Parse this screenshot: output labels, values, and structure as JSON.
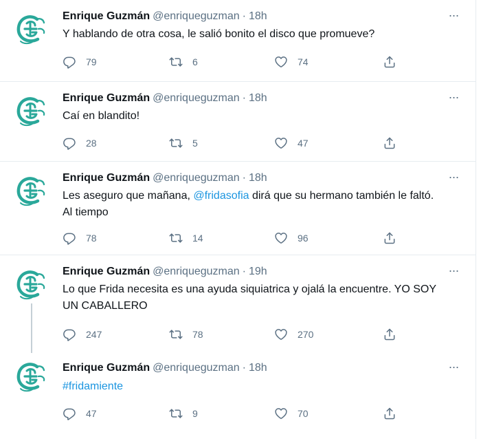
{
  "tweets": [
    {
      "name": "Enrique Guzmán",
      "handle": "@enriqueguzman",
      "dot": "·",
      "time": "18h",
      "text": "Y hablando de otra cosa, le salió bonito el disco que promueve?",
      "replies": "79",
      "retweets": "6",
      "likes": "74"
    },
    {
      "name": "Enrique Guzmán",
      "handle": "@enriqueguzman",
      "dot": "·",
      "time": "18h",
      "text": "Caí en blandito!",
      "replies": "28",
      "retweets": "5",
      "likes": "47"
    },
    {
      "name": "Enrique Guzmán",
      "handle": "@enriqueguzman",
      "dot": "·",
      "time": "18h",
      "text_before": "Les aseguro que mañana, ",
      "mention": "@fridasofia",
      "text_after": " dirá que su hermano también le faltó.",
      "text_line2": "Al tiempo",
      "replies": "78",
      "retweets": "14",
      "likes": "96"
    },
    {
      "name": "Enrique Guzmán",
      "handle": "@enriqueguzman",
      "dot": "·",
      "time": "19h",
      "text": "Lo que Frida necesita es una ayuda siquiatrica y ojalá la encuentre. YO SOY",
      "text_line2": "UN CABALLERO",
      "replies": "247",
      "retweets": "78",
      "likes": "270"
    },
    {
      "name": "Enrique Guzmán",
      "handle": "@enriqueguzman",
      "dot": "·",
      "time": "18h",
      "hashtag": "#fridamiente",
      "replies": "47",
      "retweets": "9",
      "likes": "70"
    }
  ],
  "more_label": "···",
  "icons": {
    "avatar": "eg-monogram-logo",
    "reply": "reply-icon",
    "retweet": "retweet-icon",
    "like": "heart-icon",
    "share": "share-icon",
    "more": "more-icon"
  },
  "colors": {
    "avatar_teal": "#2aa89a",
    "link": "#1b95e0",
    "secondary": "#5b7083",
    "divider": "#e6ecf0",
    "thread_line": "#c4cfd6"
  }
}
